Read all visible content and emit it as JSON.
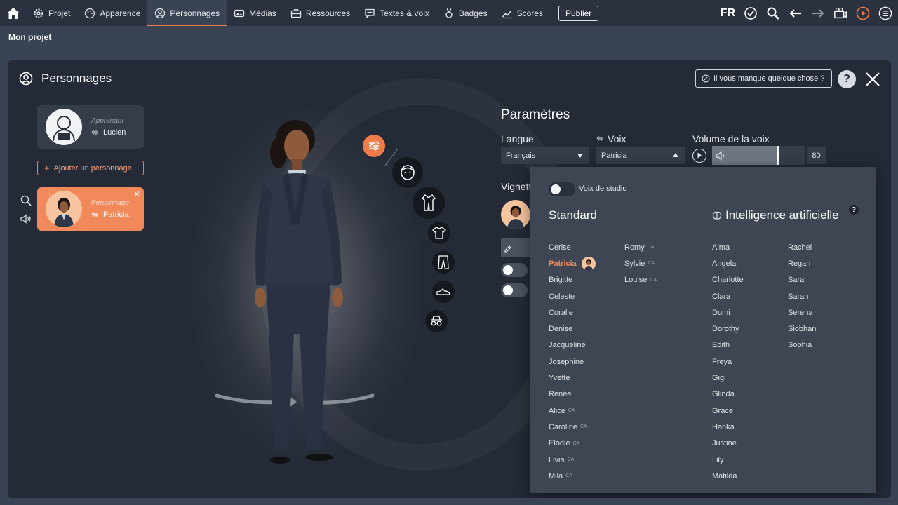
{
  "nav": {
    "items": [
      {
        "label": "Projet",
        "icon": "gear-icon"
      },
      {
        "label": "Apparence",
        "icon": "palette-icon"
      },
      {
        "label": "Personnages",
        "icon": "person-circle-icon",
        "active": true
      },
      {
        "label": "Médias",
        "icon": "media-icon"
      },
      {
        "label": "Ressources",
        "icon": "briefcase-icon"
      },
      {
        "label": "Textes & voix",
        "icon": "speech-icon"
      },
      {
        "label": "Badges",
        "icon": "badge-icon"
      },
      {
        "label": "Scores",
        "icon": "chart-icon"
      }
    ],
    "publish_label": "Publier",
    "language": "FR"
  },
  "project_name": "Mon projet",
  "panel": {
    "title": "Personnages",
    "missing_label": "Il vous manque quelque chose ?",
    "help_label": "?"
  },
  "characters": {
    "learner": {
      "role": "Apprenant",
      "name": "Lucien"
    },
    "add_label": "Ajouter un personnage",
    "active": {
      "role": "Personnage",
      "name": "Patricia"
    }
  },
  "params": {
    "title": "Paramètres",
    "language_label": "Langue",
    "language_value": "Français",
    "voice_label": "Voix",
    "voice_value": "Patricia",
    "volume_label": "Volume de la voix",
    "volume_value": "80",
    "volume_level": 0.8,
    "vignette_label": "Vignett"
  },
  "dropdown": {
    "studio_label": "Voix de studio",
    "standard_title": "Standard",
    "ai_title": "Intelligence artificielle",
    "ai_help": "?",
    "ca_tag": "CA",
    "standard_col1": [
      {
        "name": "Cerise"
      },
      {
        "name": "Patricia",
        "selected": true
      },
      {
        "name": "Brigitte"
      },
      {
        "name": "Celeste"
      },
      {
        "name": "Coralie"
      },
      {
        "name": "Denise"
      },
      {
        "name": "Jacqueline"
      },
      {
        "name": "Josephine"
      },
      {
        "name": "Yvette"
      },
      {
        "name": "Renée"
      },
      {
        "name": "Alice",
        "ca": true
      },
      {
        "name": "Caroline",
        "ca": true
      },
      {
        "name": "Elodie",
        "ca": true
      },
      {
        "name": "Livia",
        "ca": true
      },
      {
        "name": "Mila",
        "ca": true
      }
    ],
    "standard_col2": [
      {
        "name": "Romy",
        "ca": true
      },
      {
        "name": "Sylvie",
        "ca": true
      },
      {
        "name": "Louise",
        "ca": true
      }
    ],
    "ai_col1": [
      {
        "name": "Alma"
      },
      {
        "name": "Angela"
      },
      {
        "name": "Charlotte"
      },
      {
        "name": "Clara"
      },
      {
        "name": "Domi"
      },
      {
        "name": "Dorothy"
      },
      {
        "name": "Edith"
      },
      {
        "name": "Freya"
      },
      {
        "name": "Gigi"
      },
      {
        "name": "Glinda"
      },
      {
        "name": "Grace"
      },
      {
        "name": "Hanka"
      },
      {
        "name": "Justine"
      },
      {
        "name": "Lily"
      },
      {
        "name": "Matilda"
      }
    ],
    "ai_col2": [
      {
        "name": "Rachel"
      },
      {
        "name": "Regan"
      },
      {
        "name": "Sara"
      },
      {
        "name": "Sarah"
      },
      {
        "name": "Serena"
      },
      {
        "name": "Siobhan"
      },
      {
        "name": "Sophia"
      }
    ]
  },
  "colors": {
    "accent": "#f07c4a",
    "panel": "#242a36",
    "dropdown": "#3e4553"
  }
}
